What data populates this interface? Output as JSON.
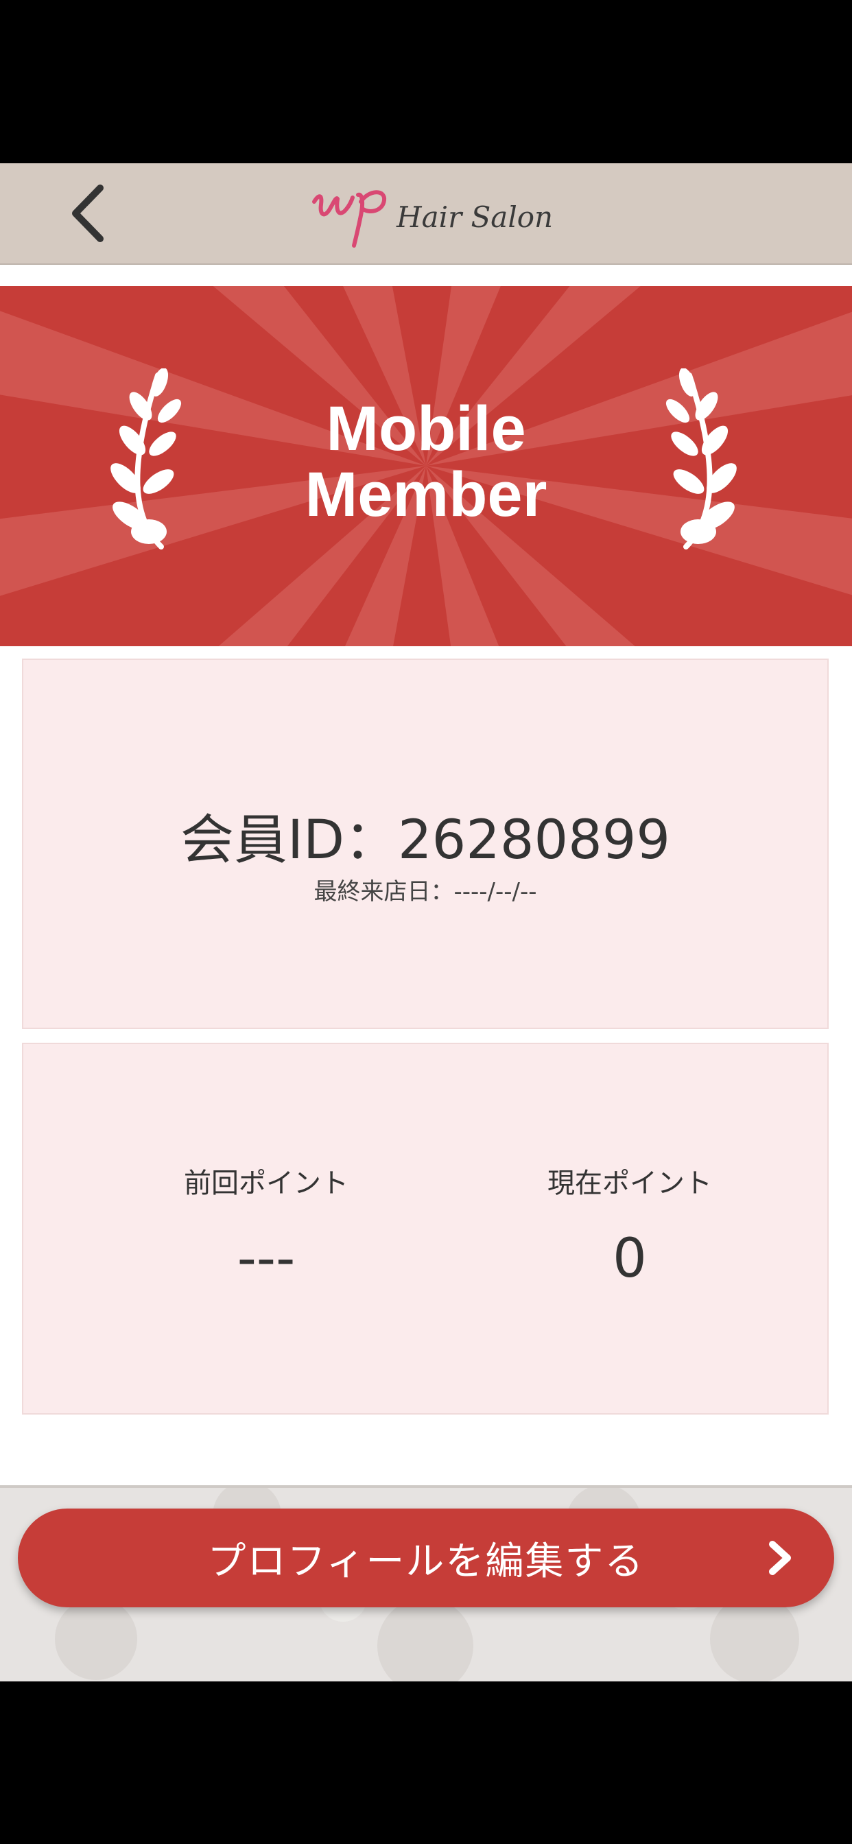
{
  "header": {
    "logo_script": "up",
    "logo_text": "Hair Salon",
    "back_icon": "chevron-left-icon"
  },
  "hero": {
    "title_line1": "Mobile",
    "title_line2": "Member",
    "icon": "laurel-icon"
  },
  "member": {
    "id_text": "会員ID：26280899",
    "last_visit_text": "最終来店日：----/--/--"
  },
  "points": {
    "previous_label": "前回ポイント",
    "previous_value": "---",
    "current_label": "現在ポイント",
    "current_value": "0"
  },
  "footer": {
    "edit_profile_label": "プロフィールを編集する",
    "edit_profile_icon": "chevron-right-icon"
  },
  "colors": {
    "accent_red": "#c63d38",
    "header_bg": "#d5cac1",
    "card_bg": "#fbebec",
    "logo_pink": "#d94873"
  }
}
